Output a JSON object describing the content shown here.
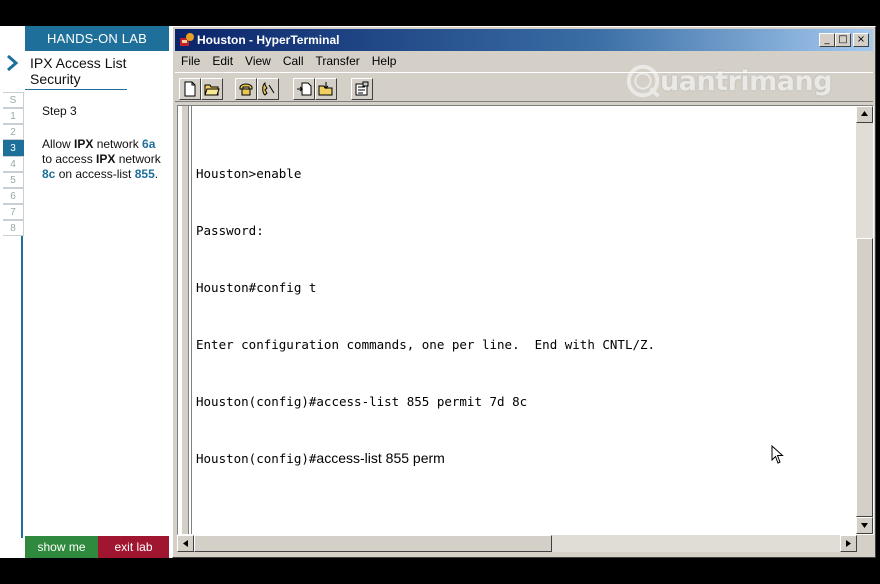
{
  "lab": {
    "header": "HANDS-ON LAB",
    "title": "IPX Access List Security",
    "step_label": "Step 3",
    "instruction": {
      "p1": "Allow ",
      "b1": "IPX",
      "p2": " network ",
      "h1": "6a",
      "p3": " to access ",
      "b2": "IPX",
      "p4": " network ",
      "h2": "8c",
      "p5": " on access-list ",
      "h3": "855",
      "p6": "."
    },
    "steps": [
      "S",
      "1",
      "2",
      "3",
      "4",
      "5",
      "6",
      "7",
      "8"
    ],
    "active_step": "3",
    "show_me": "show me",
    "exit_lab": "exit lab",
    "colors": {
      "header": "#1e6f99",
      "show": "#2f8a3e",
      "exit": "#a01530"
    }
  },
  "window": {
    "title": "Houston - HyperTerminal",
    "controls": {
      "minimize": "_",
      "maximize": "□",
      "close": "×"
    },
    "menu": [
      "File",
      "Edit",
      "View",
      "Call",
      "Transfer",
      "Help"
    ],
    "toolbar_icons": [
      "new-document-icon",
      "open-folder-icon",
      "phone-connect-icon",
      "phone-disconnect-icon",
      "send-file-icon",
      "receive-file-icon",
      "properties-icon"
    ]
  },
  "terminal": {
    "lines": [
      "Houston>enable",
      "Password:",
      "Houston#config t",
      "Enter configuration commands, one per line.  End with CNTL/Z.",
      "Houston(config)#access-list 855 permit 7d 8c"
    ],
    "current_prompt": "Houston(config)#",
    "current_input": "access-list 855 perm"
  },
  "watermark": {
    "text": "uantrimang"
  }
}
